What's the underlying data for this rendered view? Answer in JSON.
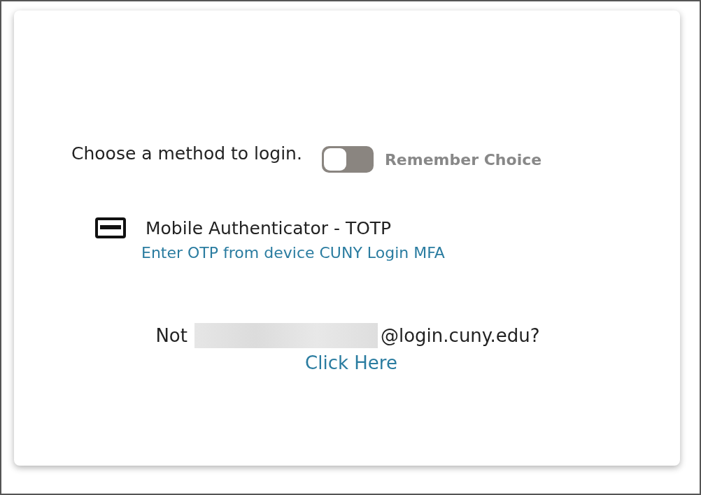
{
  "prompt": "Choose a method to login.",
  "remember_choice": {
    "label": "Remember Choice",
    "on": false
  },
  "methods": [
    {
      "title": "Mobile Authenticator - TOTP",
      "description": "Enter OTP from device CUNY Login MFA"
    }
  ],
  "account": {
    "prefix": "Not",
    "suffix": "@login.cuny.edu?",
    "link": "Click Here"
  }
}
